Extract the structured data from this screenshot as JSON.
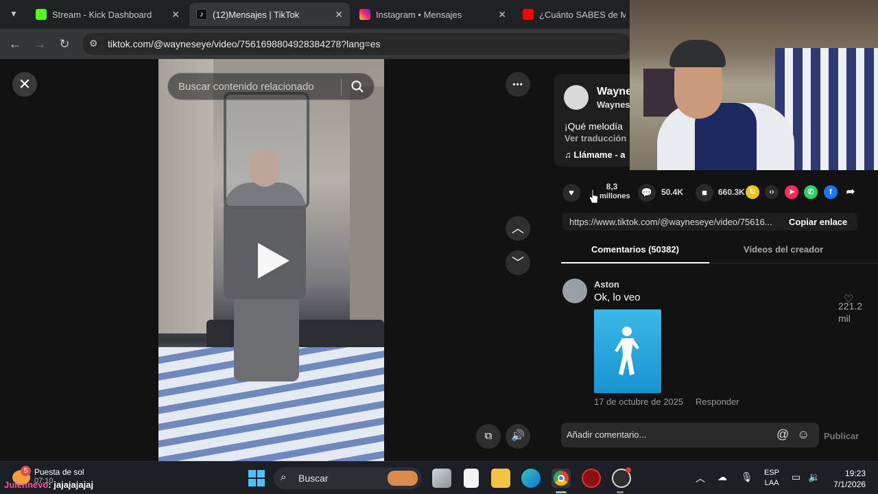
{
  "browser": {
    "tabs": [
      {
        "title": "Stream - Kick Dashboard",
        "color": "#53fc18"
      },
      {
        "title": "(12)Mensajes | TikTok",
        "color": "#ffffff"
      },
      {
        "title": "Instagram • Mensajes",
        "color": "#e1306c"
      },
      {
        "title": "¿Cuánto SABES de MINEC",
        "color": "#ff0000"
      }
    ],
    "url": "tiktok.com/@wayneseye/video/7561698804928384278?lang=es"
  },
  "video_view": {
    "search_placeholder": "Buscar contenido relacionado",
    "close_glyph": "✕",
    "more_glyph": "•••",
    "up_glyph": "︿",
    "down_glyph": "﹀"
  },
  "post": {
    "author_name": "Wayne",
    "author_handle": "Waynes",
    "description": "¡Qué melodía",
    "translate_label": "Ver traducción",
    "music": "♫  Llámame - a",
    "likes": "8,3",
    "likes_unit": "millones",
    "comments": "50.4K",
    "saves": "660.3K",
    "link": "https://www.tiktok.com/@wayneseye/video/75616...",
    "copy_label": "Copiar enlace"
  },
  "tabs": {
    "comments": "Comentarios (50382)",
    "creator_videos": "Vídeos del creador"
  },
  "comment": {
    "user": "Aston",
    "text": "Ok, lo veo",
    "date": "17 de octubre de 2025",
    "reply": "Responder",
    "likes": "221.2 mil"
  },
  "comment_input": {
    "placeholder": "Añadir comentario...",
    "at": "@",
    "emoji": "☺",
    "publish": "Publicar"
  },
  "taskbar": {
    "weather_badge": "5",
    "weather_label": "Puesta de sol",
    "weather_sub": "07:10",
    "chat_user": "Julennevo",
    "chat_message": "jajajajajaj",
    "search_label": "Buscar",
    "lang_1": "ESP",
    "lang_2": "LAA",
    "time": "19:23",
    "date": "7/1/2026"
  },
  "colors": {
    "chat_user": "#ff4da6",
    "accent_blue": "#8ab4f8"
  }
}
